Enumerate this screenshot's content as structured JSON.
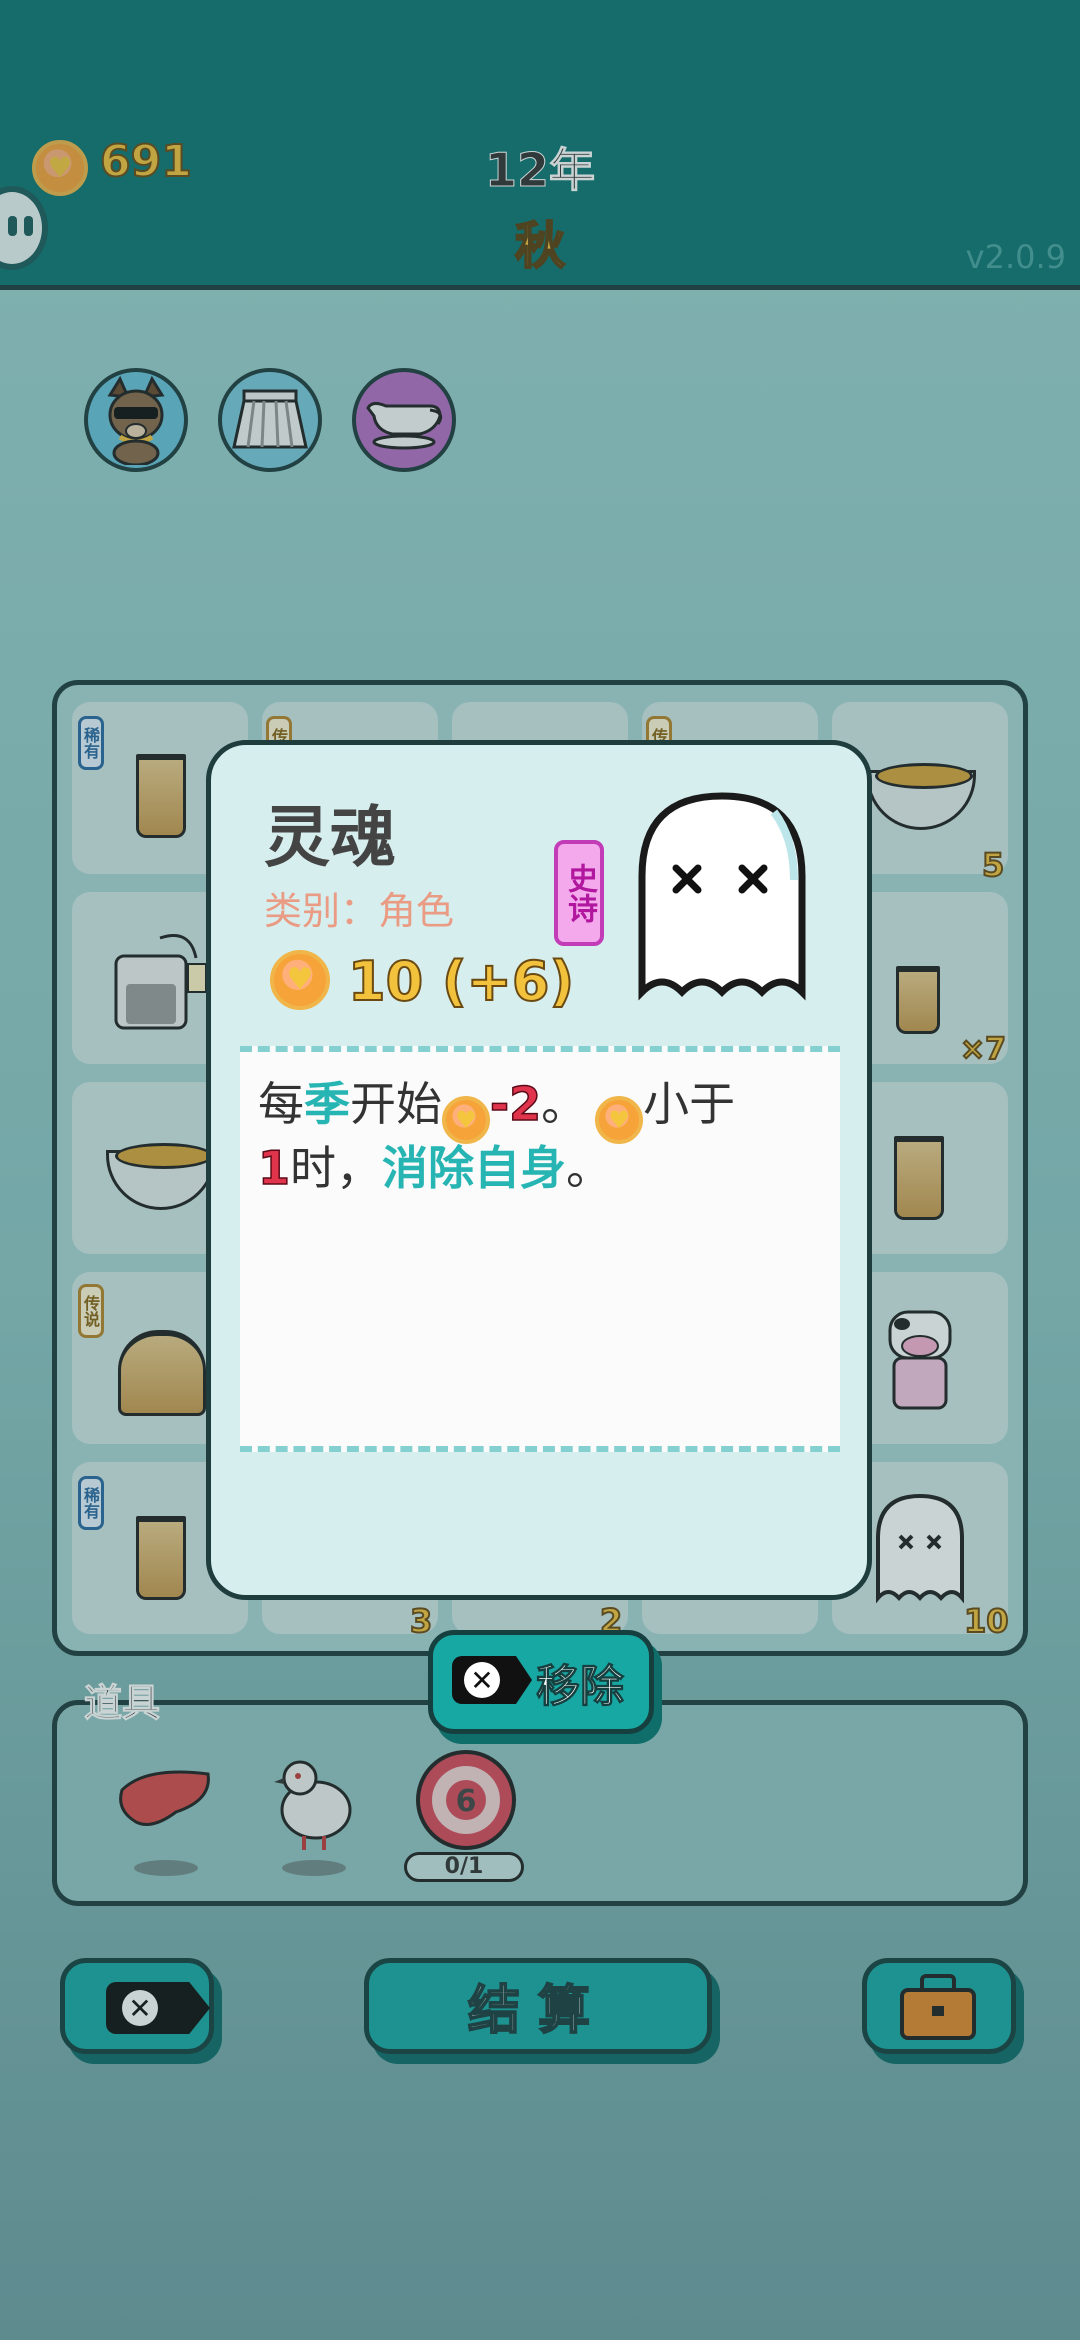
{
  "header": {
    "coins": "691",
    "year": "12年",
    "season": "秋",
    "version": "v2.0.9"
  },
  "relics": [
    {
      "icon": "dog-with-sunglasses-icon",
      "bg": "#69c1d9"
    },
    {
      "icon": "pleated-skirt-icon",
      "bg": "#7ac8dc"
    },
    {
      "icon": "gravy-boat-icon",
      "bg": "#b36fc4"
    }
  ],
  "board": {
    "tags": {
      "rare": "稀有",
      "legend": "传说",
      "legend_short": "传"
    },
    "counts": {
      "r1c5": "5",
      "r2c5": "×7",
      "r5c5": "10",
      "r5c2": "3",
      "r5c3": "2"
    }
  },
  "items_panel": {
    "title": "道具",
    "items": [
      {
        "icon": "liver-icon"
      },
      {
        "icon": "pigeon-icon"
      },
      {
        "icon": "dartboard-icon",
        "badge": "6",
        "progress": "0/1"
      }
    ]
  },
  "actions": {
    "remove_label": "移除",
    "settle_label": "结算"
  },
  "card": {
    "name": "灵魂",
    "category": "类别：角色",
    "rarity": "史诗",
    "value": "10 (+6)",
    "icon": "ghost-icon",
    "desc": {
      "l1_a": "每",
      "l1_b": "季",
      "l1_c": "开始",
      "l1_d": "-2",
      "l1_e": "。",
      "l1_f": "小于",
      "l2_a": "1",
      "l2_b": "时，",
      "l2_c": "消除自身",
      "l2_d": "。"
    }
  },
  "colors": {
    "top_bar": "#0e7673",
    "accent_teal": "#18a8a4",
    "coin_gold": "#f2c23c",
    "rarity_epic": "#c23cb8"
  }
}
